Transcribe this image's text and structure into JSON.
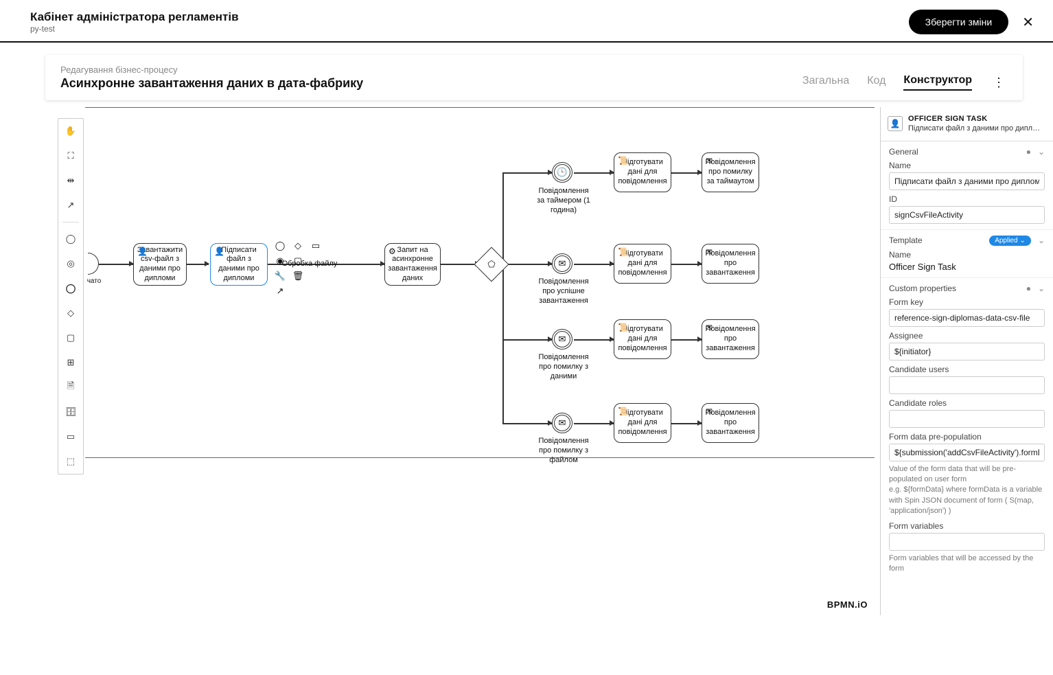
{
  "header": {
    "title": "Кабінет адміністратора регламентів",
    "subtitle": "py-test",
    "save": "Зберегти зміни"
  },
  "sub": {
    "crumb": "Редагування бізнес-процесу",
    "title": "Асинхронне завантаження даних в дата-фабрику"
  },
  "tabs": {
    "general": "Загальна",
    "code": "Код",
    "builder": "Конструктор"
  },
  "nodes": {
    "load": "Завантажити csv-файл з даними про дипломи",
    "sign": "Підписати файл з даними про дипломи",
    "process": "Обробка файлу",
    "request": "Запит на асинхронне завантаження даних",
    "evt_timer": "Повідомлення за таймером (1 година)",
    "evt_success": "Повідомлення про успішне завантаження",
    "evt_dataerr": "Повідомлення про помилку з даними",
    "evt_fileerr": "Повідомлення про помилку з файлом",
    "prep": "Підготувати дані для повідомлення",
    "msg_timeout": "Повідомлення про помилку за таймаутом",
    "msg_load": "Повідомлення про завантаження"
  },
  "panel": {
    "headType": "OFFICER SIGN TASK",
    "headName": "Підписати файл з даними про дипл…",
    "sectGeneral": "General",
    "name": "Name",
    "nameVal": "Підписати файл з даними про дипломи",
    "id": "ID",
    "idVal": "signCsvFileActivity",
    "sectTemplate": "Template",
    "applied": "Applied",
    "tplName": "Name",
    "tplNameVal": "Officer Sign Task",
    "sectCustom": "Custom properties",
    "formKey": "Form key",
    "formKeyVal": "reference-sign-diplomas-data-csv-file",
    "assignee": "Assignee",
    "assigneeVal": "${initiator}",
    "candUsers": "Candidate users",
    "candRoles": "Candidate roles",
    "prepop": "Form data pre-population",
    "prepopVal": "${submission('addCsvFileActivity').formD",
    "prepopHint": "Value of the form data that will be pre-populated on user form\ne.g. ${formData} where formData is a variable with Spin JSON document of form ( S(map, 'application/json') )",
    "formVars": "Form variables",
    "formVarsHint": "Form variables that will be accessed by the form"
  },
  "logo": "BPMN.iO"
}
